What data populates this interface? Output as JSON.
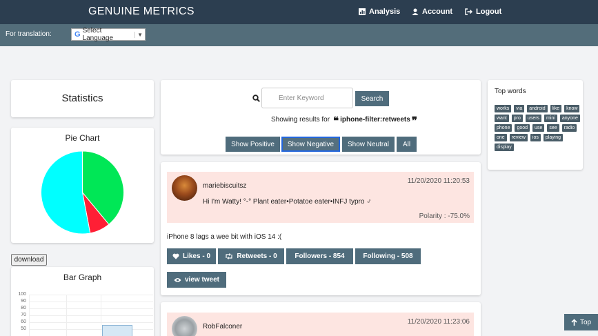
{
  "header": {
    "brand": "GENUINE METRICS",
    "nav": [
      {
        "label": "Analysis",
        "icon": "chart-icon"
      },
      {
        "label": "Account",
        "icon": "user-icon"
      },
      {
        "label": "Logout",
        "icon": "logout-icon"
      }
    ]
  },
  "translation": {
    "label": "For translation:",
    "select_value": "Select Language",
    "logo_letter": "G",
    "arrow": "▼"
  },
  "sidebar": {
    "stats_title": "Statistics",
    "pie_title": "Pie Chart",
    "download_label": "download",
    "bar_title": "Bar Graph",
    "bar_ticks": [
      "100",
      "90",
      "80",
      "70",
      "60",
      "50"
    ]
  },
  "chart_data": {
    "type": "pie",
    "labels": [],
    "values": [
      39,
      8,
      53
    ],
    "colors": [
      "#00e756",
      "#ff1f35",
      "#00ffff"
    ]
  },
  "search": {
    "placeholder": "Enter Keyword",
    "button": "Search",
    "showing_prefix": "Showing results for",
    "open_quote": "❝",
    "close_quote": "❞",
    "term": "iphone-filter:retweets",
    "filters": [
      "Show Positive",
      "Show Negative",
      "Show Neutral",
      "All"
    ],
    "active_filter": "Show Negative"
  },
  "tweets": [
    {
      "username": "mariebiscuitsz",
      "date": "11/20/2020 11:20:53",
      "bio": "Hi I'm Watty! °-° Plant eater•Potatoe eater•INFJ typro ♂",
      "polarity": "Polarity : -75.0%",
      "text": "iPhone 8 lags a wee bit with iOS 14 :(",
      "likes": "Likes - 0",
      "retweets": "Retweets - 0",
      "followers": "Followers - 854",
      "following": "Following - 508",
      "view": "view tweet"
    },
    {
      "username": "RobFalconer",
      "date": "11/20/2020 11:23:06"
    }
  ],
  "top_words": {
    "title": "Top words",
    "words": [
      "works",
      "via",
      "android",
      "like",
      "know",
      "want",
      "pro",
      "users",
      "mini",
      "anyone",
      "phone",
      "good",
      "use",
      "see",
      "radio",
      "one",
      "review",
      "ios",
      "playing",
      "display"
    ]
  },
  "top_button": "Top"
}
